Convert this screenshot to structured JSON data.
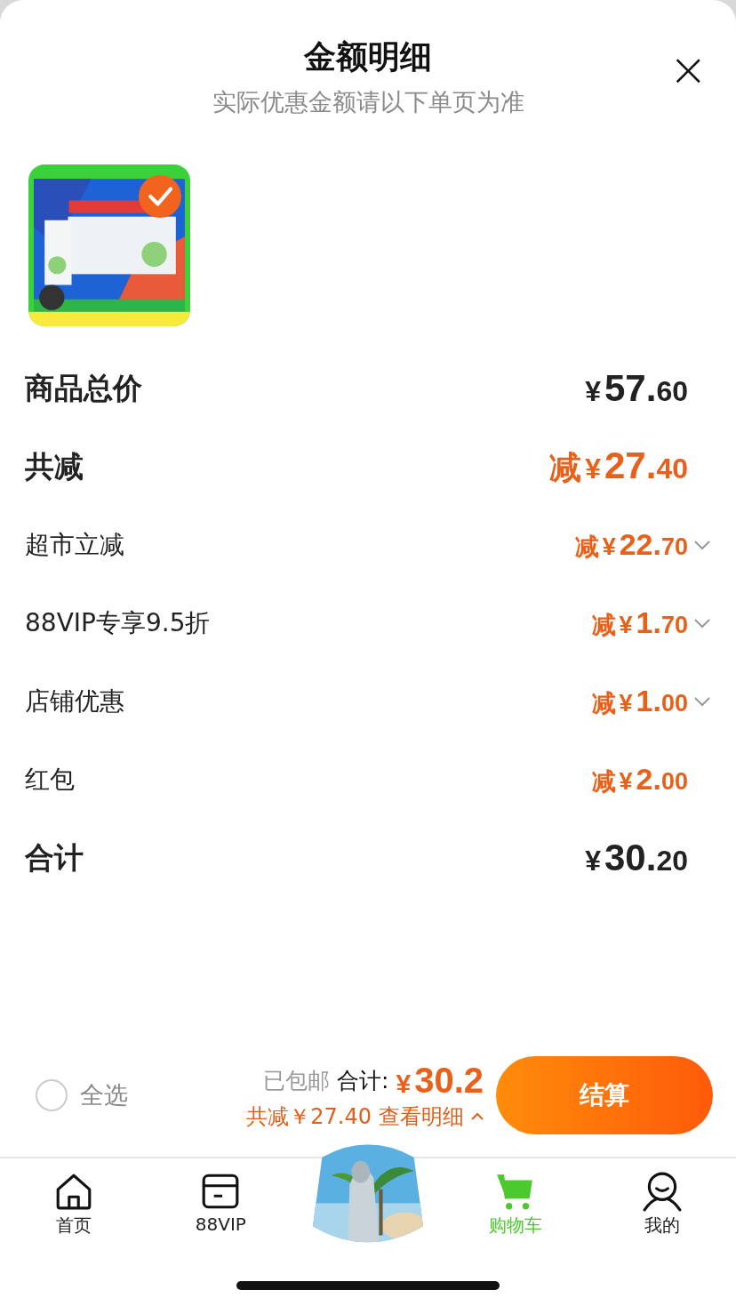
{
  "sheet": {
    "title": "金额明细",
    "subtitle": "实际优惠金额请以下单页为准",
    "close": "×"
  },
  "product": {
    "kind": "picture",
    "selected": true
  },
  "rows": [
    {
      "label": "商品总价",
      "kind": "major",
      "discount": false,
      "expandable": false,
      "currency": "¥",
      "amount": "57.",
      "cents": "60"
    },
    {
      "label": "共减",
      "kind": "major",
      "discount": true,
      "expandable": false,
      "prefix": "减",
      "currency": "¥",
      "amount": "27.",
      "cents": "40"
    },
    {
      "label": "超市立减",
      "kind": "minor",
      "discount": true,
      "expandable": true,
      "prefix": "减",
      "currency": "¥",
      "amount": "22.",
      "cents": "70"
    },
    {
      "label": "88VIP专享9.5折",
      "kind": "minor",
      "discount": true,
      "expandable": true,
      "prefix": "减",
      "currency": "¥",
      "amount": "1.",
      "cents": "70"
    },
    {
      "label": "店铺优惠",
      "kind": "minor",
      "discount": true,
      "expandable": true,
      "prefix": "减",
      "currency": "¥",
      "amount": "1.",
      "cents": "00"
    },
    {
      "label": "红包",
      "kind": "minor",
      "discount": true,
      "expandable": false,
      "prefix": "减",
      "currency": "¥",
      "amount": "2.",
      "cents": "00"
    },
    {
      "label": "合计",
      "kind": "major",
      "discount": false,
      "expandable": false,
      "currency": "¥",
      "amount": "30.",
      "cents": "20"
    }
  ],
  "checkout": {
    "select_all": {
      "label": "全选",
      "checked": false
    },
    "shipping": "已包邮",
    "total_label": "合计:",
    "total_currency": "¥",
    "total": "30.2",
    "saved": "共减￥27.40",
    "details_link": "查看明细",
    "button": "结算"
  },
  "tabs": [
    {
      "kind": "home",
      "label": "首页",
      "selected": false
    },
    {
      "kind": "card",
      "label": "88VIP",
      "selected": false
    },
    {
      "kind": "picture",
      "selected": false
    },
    {
      "kind": "cart",
      "label": "购物车",
      "selected": true
    },
    {
      "kind": "profile",
      "label": "我的",
      "selected": false
    }
  ]
}
